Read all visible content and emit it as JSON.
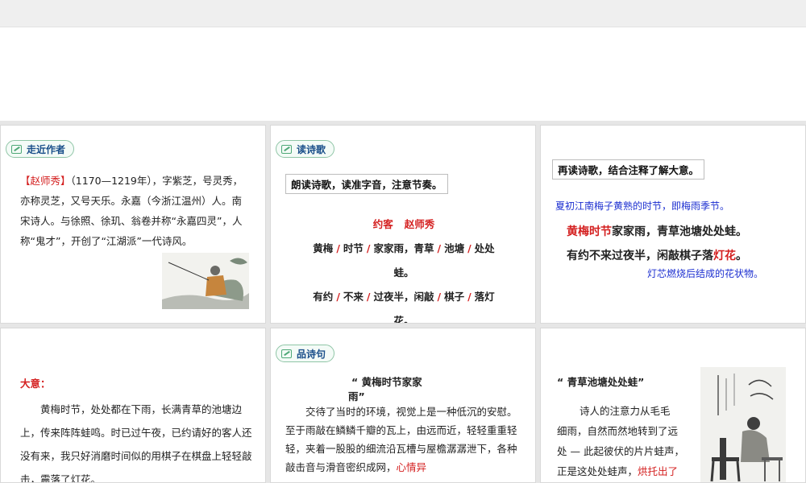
{
  "slide1": {
    "tag": "走近作者",
    "author_name": "【赵师秀】",
    "bio": "（1170—1219年），字紫芝，号灵秀，亦称灵芝，又号天乐。永嘉（今浙江温州）人。南宋诗人。与徐照、徐玑、翁卷并称“永嘉四灵”，人称“鬼才”，开创了“江湖派”一代诗风。"
  },
  "slide2": {
    "tag": "读诗歌",
    "instruction": "朗读诗歌，读准字音，注意节奏。",
    "poem_title": "约客",
    "poem_author": "赵师秀",
    "line1": [
      "黄梅",
      "时节",
      "家家雨，青草",
      "池塘",
      "处处"
    ],
    "line2": "蛙。",
    "line3": [
      "有约",
      "不来",
      "过夜半，闲敲",
      "棋子",
      "落灯"
    ],
    "line4": "花。"
  },
  "slide3": {
    "instruction": "再读诗歌，结合注释了解大意。",
    "note1": "夏初江南梅子黄熟的时节，即梅雨季节。",
    "line1_highlight": "黄梅时节",
    "line1_rest": "家家雨，青草池塘处处蛙。",
    "line2_rest": "有约不来过夜半，闲敲棋子落",
    "line2_highlight": "灯花",
    "line2_end": "。",
    "note2": "灯芯燃烧后结成的花状物。"
  },
  "slide4": {
    "heading": "大意：",
    "text": "黄梅时节，处处都在下雨，长满青草的池塘边上，传来阵阵蛙鸣。时已过午夜，已约请好的客人还没有来，我只好消磨时间似的用棋子在棋盘上轻轻敲击，震落了灯花。"
  },
  "slide5": {
    "tag": "品诗句",
    "quote_a": "“ 黄梅时节家家",
    "quote_b": "雨”",
    "text": "交待了当时的环境，视觉上是一种低沉的安慰。至于雨敲在鳞鳞千瓣的瓦上，由远而近，轻轻重重轻轻，夹着一股股的细流沿瓦槽与屋檐潺潺泄下，各种敲击音与滑音密织成网，",
    "text_red": "心情异"
  },
  "slide6": {
    "quote": "“ 青草池塘处处蛙”",
    "t1": "诗人的注意力从毛毛",
    "t2": "细雨，自然而然地转到了远",
    "t3": "处 — 此起彼伏的片片蛙声，",
    "t4": "正是这处处蛙声，",
    "t4_red": "烘托出了"
  },
  "colors": {
    "accent_red": "#d42020",
    "accent_blue": "#1c2fd0",
    "tag_green": "#4ea877",
    "tag_text": "#1a4f8a"
  }
}
